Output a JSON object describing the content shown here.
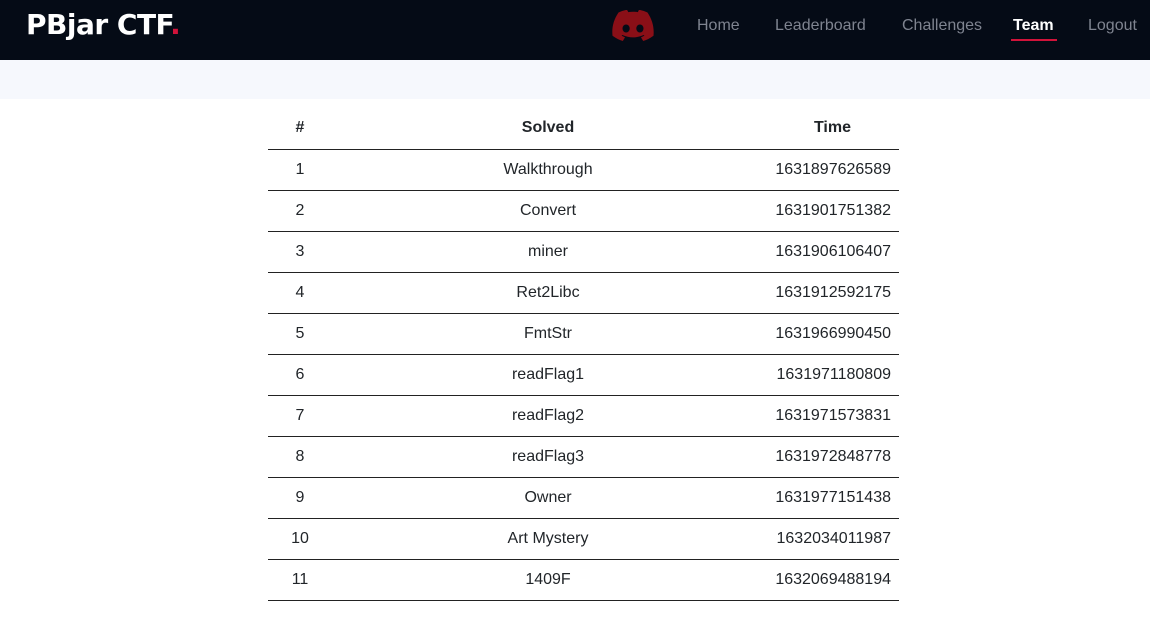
{
  "nav": {
    "brand_text": "PBjar CTF",
    "brand_dot": ".",
    "discord_icon": "discord-icon",
    "links": [
      {
        "label": "Home",
        "active": false
      },
      {
        "label": "Leaderboard",
        "active": false
      },
      {
        "label": "Challenges",
        "active": false
      },
      {
        "label": "Team",
        "active": true
      },
      {
        "label": "Logout",
        "active": false
      }
    ],
    "accent_color": "#d1133a"
  },
  "table": {
    "headers": [
      "#",
      "Solved",
      "Time"
    ],
    "rows": [
      {
        "num": "1",
        "solved": "Walkthrough",
        "time": "1631897626589"
      },
      {
        "num": "2",
        "solved": "Convert",
        "time": "1631901751382"
      },
      {
        "num": "3",
        "solved": "miner",
        "time": "1631906106407"
      },
      {
        "num": "4",
        "solved": "Ret2Libc",
        "time": "1631912592175"
      },
      {
        "num": "5",
        "solved": "FmtStr",
        "time": "1631966990450"
      },
      {
        "num": "6",
        "solved": "readFlag1",
        "time": "1631971180809"
      },
      {
        "num": "7",
        "solved": "readFlag2",
        "time": "1631971573831"
      },
      {
        "num": "8",
        "solved": "readFlag3",
        "time": "1631972848778"
      },
      {
        "num": "9",
        "solved": "Owner",
        "time": "1631977151438"
      },
      {
        "num": "10",
        "solved": "Art Mystery",
        "time": "1632034011987"
      },
      {
        "num": "11",
        "solved": "1409F",
        "time": "1632069488194"
      }
    ]
  }
}
